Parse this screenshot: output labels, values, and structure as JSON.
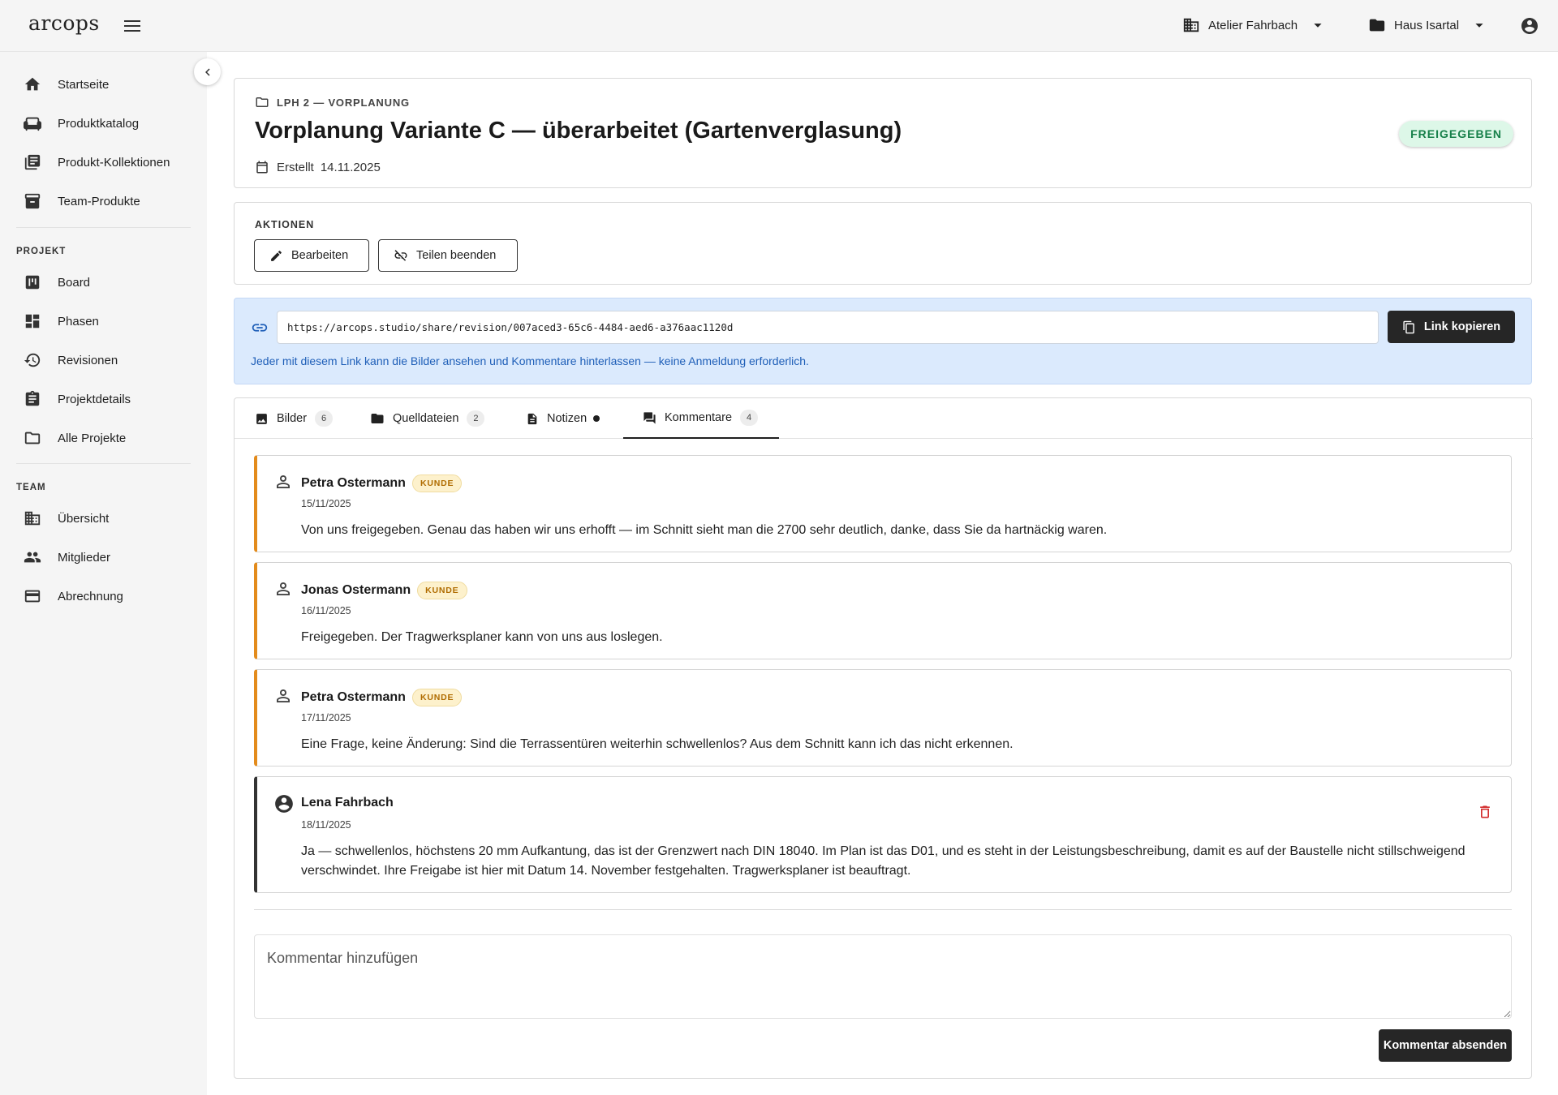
{
  "app": {
    "logo": "arcops"
  },
  "topbar": {
    "org_label": "Atelier Fahrbach",
    "project_label": "Haus Isartal"
  },
  "sidebar": {
    "items": [
      {
        "label": "Startseite",
        "icon": "home-icon"
      },
      {
        "label": "Produktkatalog",
        "icon": "sofa-icon"
      },
      {
        "label": "Produkt-Kollektionen",
        "icon": "collections-icon"
      },
      {
        "label": "Team-Produkte",
        "icon": "archive-icon"
      }
    ],
    "project_section": "PROJEKT",
    "project_items": [
      {
        "label": "Board",
        "icon": "board-icon"
      },
      {
        "label": "Phasen",
        "icon": "dashboard-icon"
      },
      {
        "label": "Revisionen",
        "icon": "history-icon"
      },
      {
        "label": "Projektdetails",
        "icon": "clipboard-icon"
      },
      {
        "label": "Alle Projekte",
        "icon": "folder-icon"
      }
    ],
    "team_section": "TEAM",
    "team_items": [
      {
        "label": "Übersicht",
        "icon": "building-icon"
      },
      {
        "label": "Mitglieder",
        "icon": "people-icon"
      },
      {
        "label": "Abrechnung",
        "icon": "credit-card-icon"
      }
    ]
  },
  "header": {
    "breadcrumb": "LPH 2 — VORPLANUNG",
    "title": "Vorplanung Variante C — überarbeitet (Gartenverglasung)",
    "created_label": "Erstellt",
    "created_date": "14.11.2025",
    "status": "FREIGEGEBEN",
    "status_color": "#17804a"
  },
  "actions": {
    "title": "AKTIONEN",
    "edit_label": "Bearbeiten",
    "stop_share_label": "Teilen beenden"
  },
  "share": {
    "url": "https://arcops.studio/share/revision/007aced3-65c6-4484-aed6-a376aac1120d",
    "copy_label": "Link kopieren",
    "hint": "Jeder mit diesem Link kann die Bilder ansehen und Kommentare hinterlassen — keine Anmeldung erforderlich."
  },
  "tabs": [
    {
      "label": "Bilder",
      "count": "6"
    },
    {
      "label": "Quelldateien",
      "count": "2"
    },
    {
      "label": "Notizen"
    },
    {
      "label": "Kommentare",
      "count": "4"
    }
  ],
  "comments": [
    {
      "author": "Petra Ostermann",
      "role": "KUNDE",
      "date": "15/11/2025",
      "text": "Von uns freigegeben. Genau das haben wir uns erhofft — im Schnitt sieht man die 2700 sehr deutlich, danke, dass Sie da hartnäckig waren."
    },
    {
      "author": "Jonas Ostermann",
      "role": "KUNDE",
      "date": "16/11/2025",
      "text": "Freigegeben. Der Tragwerksplaner kann von uns aus loslegen."
    },
    {
      "author": "Petra Ostermann",
      "role": "KUNDE",
      "date": "17/11/2025",
      "text": "Eine Frage, keine Änderung: Sind die Terrassentüren weiterhin schwellenlos? Aus dem Schnitt kann ich das nicht erkennen."
    },
    {
      "author": "Lena Fahrbach",
      "date": "18/11/2025",
      "text": "Ja — schwellenlos, höchstens 20 mm Aufkantung, das ist der Grenzwert nach DIN 18040. Im Plan ist das D01, und es steht in der Leistungsbeschreibung, damit es auf der Baustelle nicht stillschweigend verschwindet. Ihre Freigabe ist hier mit Datum 14. November festgehalten. Tragwerksplaner ist beauftragt."
    }
  ],
  "composer": {
    "placeholder": "Kommentar hinzufügen",
    "send_label": "Kommentar absenden"
  },
  "colors": {
    "client_accent": "#e38b1c",
    "own_accent": "#333333",
    "share_bg": "#dbeafd",
    "primary_button": "#262626",
    "delete": "#d32f2f"
  }
}
